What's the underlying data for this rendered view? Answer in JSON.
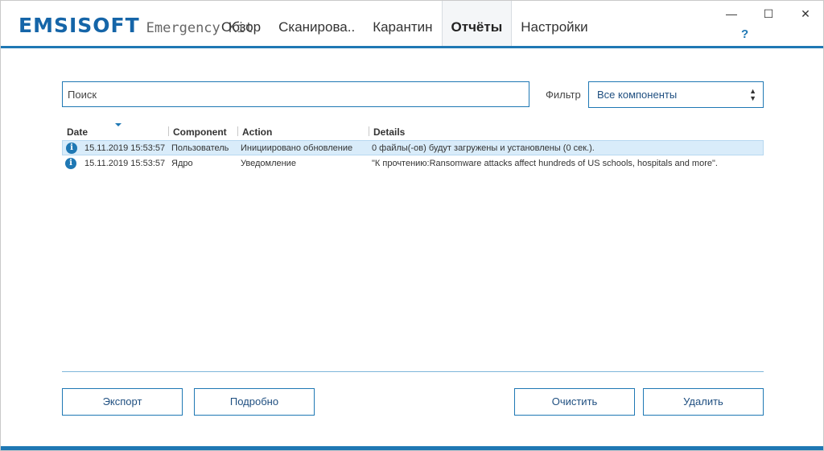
{
  "app": {
    "brand_main": "EMSISOFT",
    "brand_sub": "Emergency Kit",
    "help": "?"
  },
  "tabs": [
    {
      "label": "Обзор"
    },
    {
      "label": "Сканирова.."
    },
    {
      "label": "Карантин"
    },
    {
      "label": "Отчёты",
      "active": true
    },
    {
      "label": "Настройки"
    }
  ],
  "window_controls": {
    "minimize": "—",
    "maximize": "☐",
    "close": "✕"
  },
  "search": {
    "placeholder": "Поиск",
    "value": ""
  },
  "filter": {
    "label": "Фильтр",
    "selected": "Все компоненты"
  },
  "table": {
    "columns": [
      "Date",
      "Component",
      "Action",
      "Details"
    ],
    "sort_column": "Date",
    "rows": [
      {
        "date": "15.11.2019 15:53:57",
        "component": "Пользователь",
        "action": "Инициировано обновление",
        "details": "0 файлы(-ов) будут загружены и установлены (0 сек.).",
        "selected": true
      },
      {
        "date": "15.11.2019 15:53:57",
        "component": "Ядро",
        "action": "Уведомление",
        "details": "\"К прочтению:Ransomware attacks affect hundreds of US schools, hospitals and more\".",
        "selected": false
      }
    ]
  },
  "buttons": {
    "export": "Экспорт",
    "details": "Подробно",
    "clear": "Очистить",
    "delete": "Удалить"
  },
  "colors": {
    "accent": "#1f78b4",
    "selected_row": "#d9ecfa"
  }
}
